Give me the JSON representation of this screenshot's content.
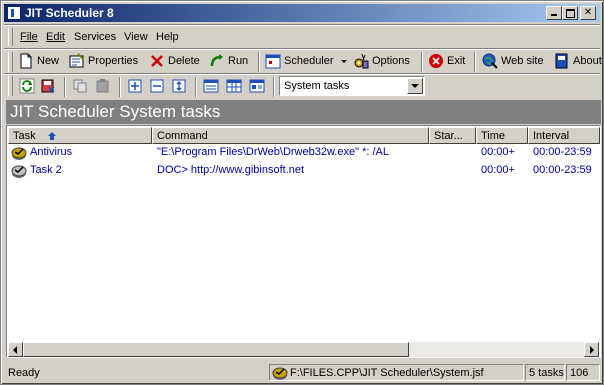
{
  "window": {
    "title": "JIT Scheduler 8"
  },
  "menu": [
    {
      "label": "File"
    },
    {
      "label": "Edit"
    },
    {
      "label": "Services"
    },
    {
      "label": "View"
    },
    {
      "label": "Help"
    }
  ],
  "toolbar": {
    "new": "New",
    "properties": "Properties",
    "delete": "Delete",
    "run": "Run",
    "scheduler": "Scheduler",
    "options": "Options",
    "exit": "Exit",
    "website": "Web site",
    "about": "About"
  },
  "filter": {
    "selected": "System tasks"
  },
  "banner": {
    "title": "JIT Scheduler System tasks"
  },
  "table": {
    "columns": [
      "Task",
      "Command",
      "Star...",
      "Time",
      "Interval"
    ],
    "rows": [
      {
        "task": "Antivirus",
        "command": "\"E:\\Program Files\\DrWeb\\Drweb32w.exe\" *: /AL",
        "start": "",
        "time": "00:00+",
        "interval": "00:00-23:59"
      },
      {
        "task": "Task 2",
        "command": "DOC> http://www.gibinsoft.net",
        "start": "",
        "time": "00:00+",
        "interval": "00:00-23:59"
      }
    ]
  },
  "status": {
    "ready": "Ready",
    "file": "F:\\FILES.CPP\\JIT Scheduler\\System.jsf",
    "count": "5 tasks",
    "extra": "106"
  },
  "colors": {
    "title_start": "#0a246a",
    "title_end": "#a6caf0",
    "banner_bg": "#808080",
    "link_text": "#0000a8"
  }
}
